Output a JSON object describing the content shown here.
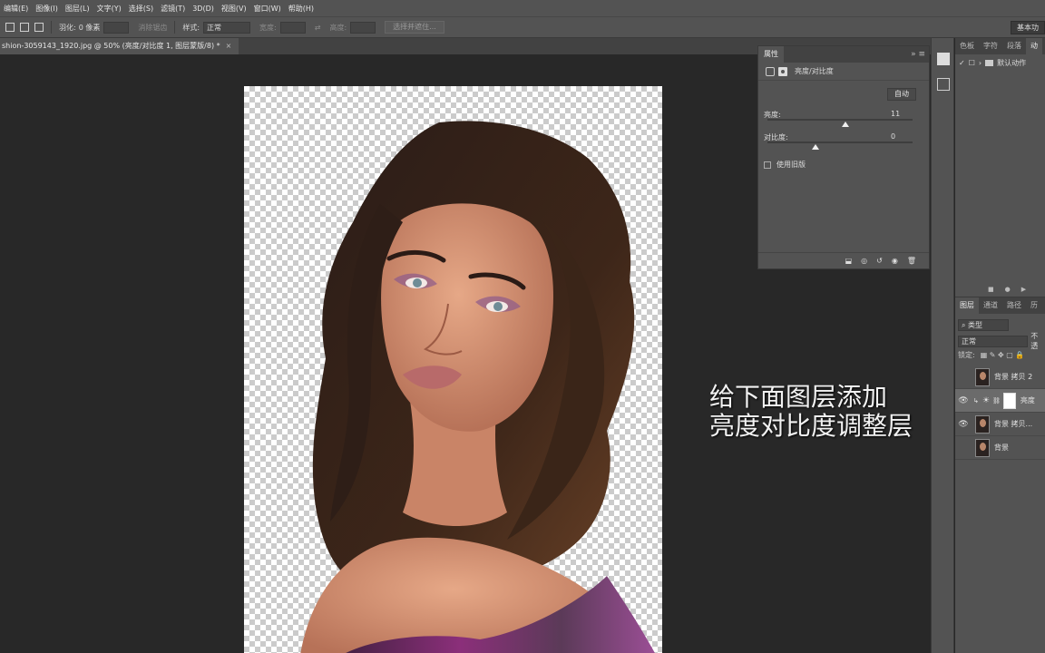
{
  "menu": {
    "items": [
      "编辑(E)",
      "图像(I)",
      "图层(L)",
      "文字(Y)",
      "选择(S)",
      "滤镜(T)",
      "3D(D)",
      "视图(V)",
      "窗口(W)",
      "帮助(H)"
    ]
  },
  "options_bar": {
    "feather_label": "羽化:",
    "feather_value": "0 像素",
    "antialias_label": "消除锯齿",
    "style_label": "样式:",
    "style_value": "正常",
    "width_label": "宽度:",
    "height_label": "高度:",
    "select_and_mask_label": "选择并遮住...",
    "workspace_label": "基本功"
  },
  "document_tab": {
    "title": "shion-3059143_1920.jpg @ 50% (亮度/对比度 1, 图层蒙版/8) *",
    "close": "×"
  },
  "caption": {
    "line1": "给下面图层添加",
    "line2": "亮度对比度调整层"
  },
  "properties": {
    "tab": "属性",
    "collapse": "»",
    "title": "亮度/对比度",
    "auto_label": "自动",
    "brightness_label": "亮度:",
    "brightness_value": "11",
    "brightness": 11,
    "contrast_label": "对比度:",
    "contrast_value": "0",
    "contrast": 0,
    "legacy_label": "使用旧版"
  },
  "right_panel": {
    "tabs": [
      "色板",
      "字符",
      "段落",
      "动"
    ],
    "action_set": "默认动作"
  },
  "layers_panel": {
    "tabs": [
      "图层",
      "通道",
      "路径",
      "历"
    ],
    "filter_value": "类型",
    "blend_value": "正常",
    "opacity_label": "不透",
    "lock_label": "锁定:",
    "layers": [
      {
        "name": "背景 拷贝 2",
        "visible": false
      },
      {
        "name": "亮度",
        "visible": true,
        "selected": true
      },
      {
        "name": "背景 拷贝...",
        "visible": true
      },
      {
        "name": "背景",
        "visible": false
      }
    ]
  },
  "colors": {
    "ui_dark": "#535353",
    "canvas_bg": "#282828",
    "caption": "#f2f2f2"
  }
}
